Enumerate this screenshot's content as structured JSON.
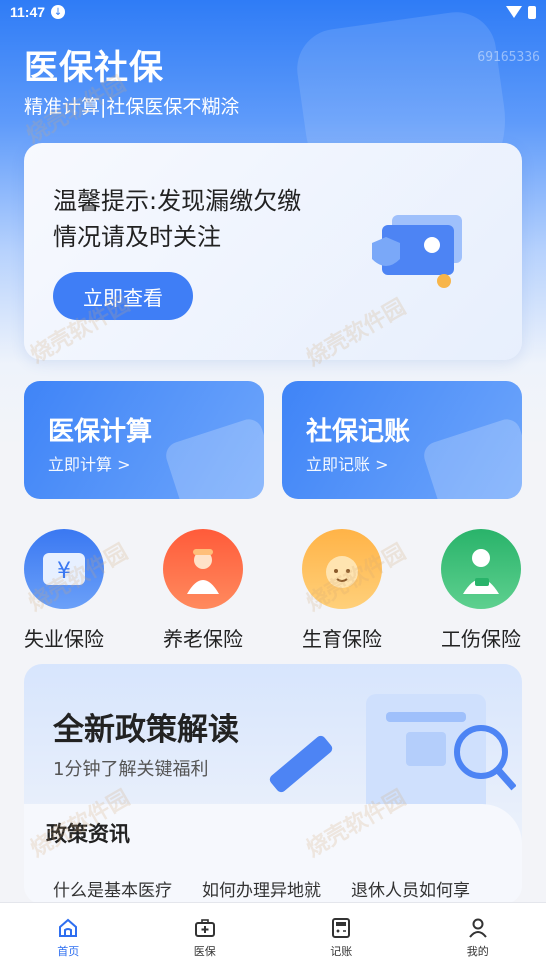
{
  "status_bar": {
    "time": "11:47"
  },
  "header": {
    "title": "医保社保",
    "subtitle": "精准计算|社保医保不糊涂",
    "user_id": "69165336"
  },
  "notice": {
    "text": "温馨提示:发现漏缴欠缴情况请及时关注",
    "button_label": "立即查看"
  },
  "quick_cards": [
    {
      "title": "医保计算",
      "subtitle": "立即计算 >"
    },
    {
      "title": "社保记账",
      "subtitle": "立即记账 >"
    }
  ],
  "insurance_types": [
    {
      "label": "失业保险",
      "icon": "yen-card-icon",
      "color": "#3a78f2"
    },
    {
      "label": "养老保险",
      "icon": "elderly-person-icon",
      "color": "#ff5b3a"
    },
    {
      "label": "生育保险",
      "icon": "baby-icon",
      "color": "#ffb347"
    },
    {
      "label": "工伤保险",
      "icon": "injured-worker-icon",
      "color": "#29b36a"
    }
  ],
  "policy": {
    "title": "全新政策解读",
    "subtitle": "1分钟了解关键福利",
    "news_tab": "政策资讯",
    "news_items": [
      "什么是基本医疗",
      "如何办理异地就",
      "退休人员如何享"
    ]
  },
  "bottom_nav": [
    {
      "label": "首页",
      "icon": "home-icon",
      "active": true
    },
    {
      "label": "医保",
      "icon": "medical-kit-icon",
      "active": false
    },
    {
      "label": "记账",
      "icon": "calculator-icon",
      "active": false
    },
    {
      "label": "我的",
      "icon": "profile-icon",
      "active": false
    }
  ],
  "watermark": "烧壳软件园",
  "colors": {
    "primary": "#2f7cf6",
    "button": "#3f7ef6",
    "nav_active": "#2f6ff0"
  }
}
